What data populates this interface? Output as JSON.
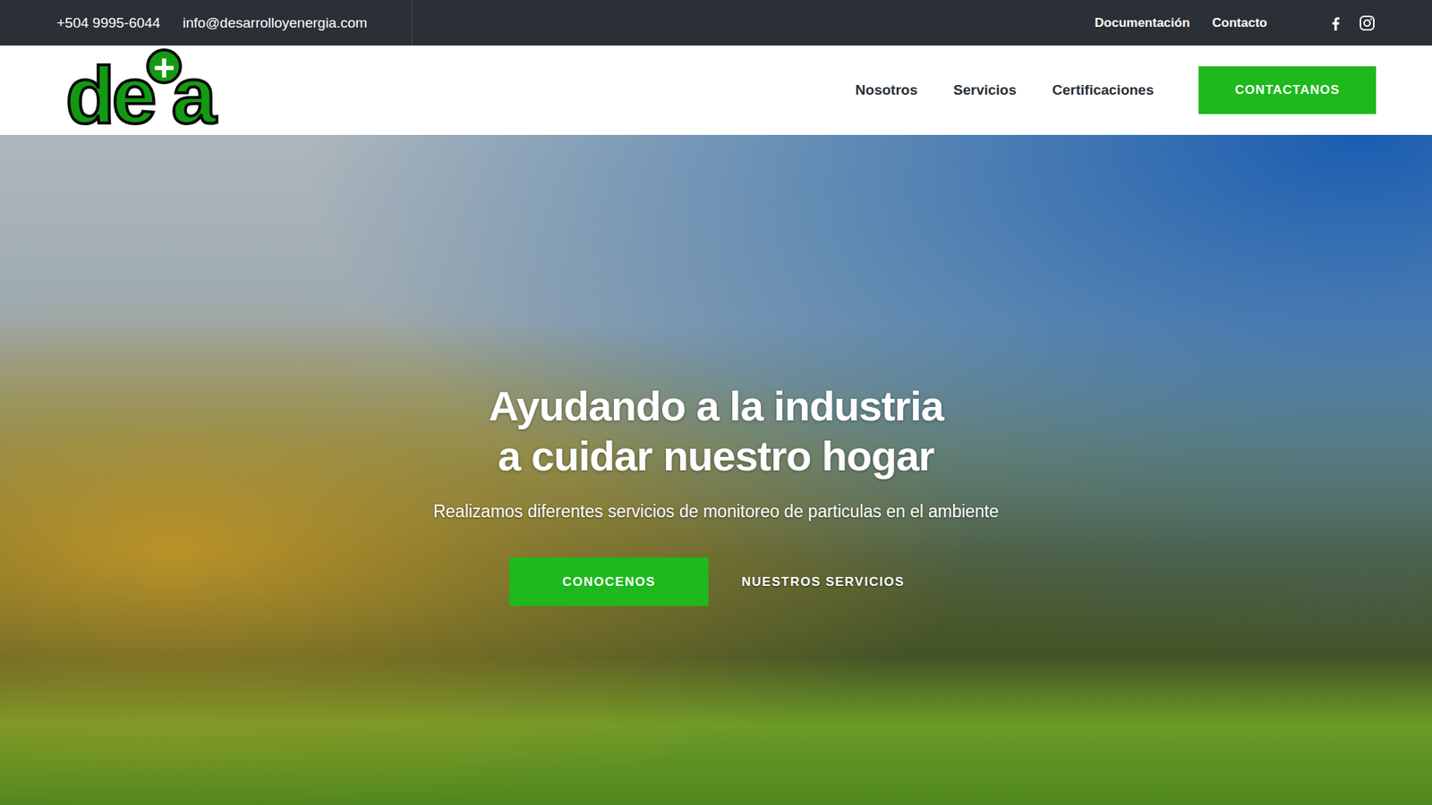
{
  "topbar": {
    "phone": "+504 9995-6044",
    "email": "info@desarrolloyenergia.com",
    "links": [
      {
        "label": "Documentación"
      },
      {
        "label": "Contacto"
      }
    ]
  },
  "logo": {
    "left": "de",
    "mark": "+",
    "right": "a"
  },
  "nav": {
    "items": [
      {
        "label": "Nosotros",
        "selected": false
      },
      {
        "label": "Servicios",
        "selected": false
      },
      {
        "label": "Certificaciones",
        "selected": false
      }
    ],
    "cta": "CONTACTANOS"
  },
  "hero": {
    "title_lines": [
      "Ayudando a la industria",
      "a cuidar nuestro hogar"
    ],
    "subtitle": "Realizamos diferentes servicios de monitoreo de particulas en el ambiente",
    "buttons": [
      {
        "label": "CONOCENOS",
        "kind": "filled"
      },
      {
        "label": "NUESTROS SERVICIOS",
        "kind": "text"
      }
    ]
  }
}
